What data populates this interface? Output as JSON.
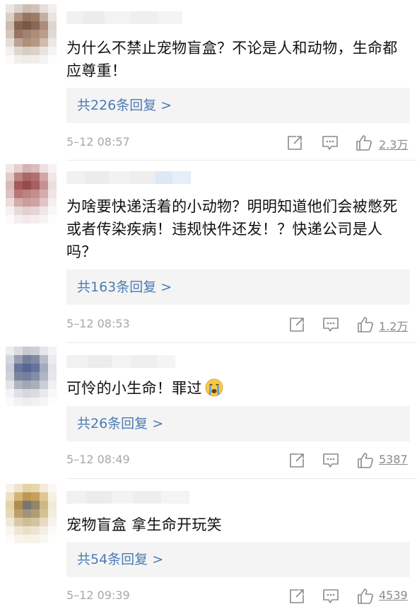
{
  "comments": [
    {
      "text": "为什么不禁止宠物盲盒？不论是人和动物，生命都应尊重！",
      "reply_label": "共226条回复 >",
      "time": "5–12 08:57",
      "likes": "2.3万"
    },
    {
      "text": "为啥要快递活着的小动物？明明知道他们会被憋死或者传染疾病！违规快件还发！？快递公司是人吗？",
      "reply_label": "共163条回复 >",
      "time": "5–12 08:53",
      "likes": "1.2万"
    },
    {
      "text": "可怜的小生命！罪过",
      "emoji": "crying-face-emoji",
      "reply_label": "共26条回复 >",
      "time": "5–12 08:49",
      "likes": "5387"
    },
    {
      "text": "宠物盲盒 拿生命开玩笑",
      "reply_label": "共54条回复 >",
      "time": "5–12 09:39",
      "likes": "4539"
    }
  ],
  "icons": {
    "share": "share-icon",
    "comment": "comment-icon",
    "like": "thumbs-up-icon"
  },
  "colors": {
    "reply_link": "#4a7bb4",
    "reply_box_bg": "#f4f4f4",
    "text": "#111111",
    "meta": "#a8a8a8"
  }
}
